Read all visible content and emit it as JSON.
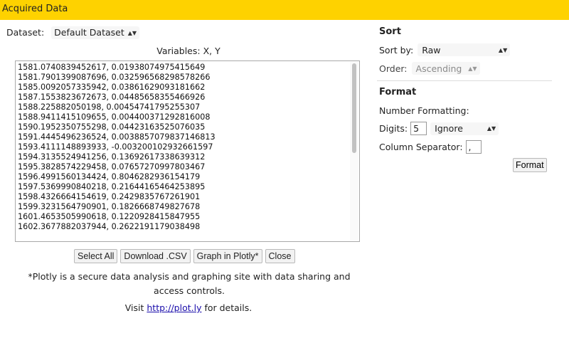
{
  "header": {
    "title": "Acquired Data"
  },
  "dataset": {
    "label": "Dataset:",
    "selected": "Default Dataset"
  },
  "variables": {
    "label": "Variables: X, Y"
  },
  "data_lines": [
    "1581.0740839452617, 0.01938074975415649",
    "1581.7901399087696, 0.032596568298578266",
    "1585.0092057335942, 0.03861629093181662",
    "1587.1553823672673, 0.04485658355466926",
    "1588.225882050198, 0.00454741795255307",
    "1588.9411415109655, 0.004400371292816008",
    "1590.1952350755298, 0.04423163525076035",
    "1591.4445496236524, 0.0038857079837146813",
    "1593.4111148893933, -0.003200102932661597",
    "1594.3135524941256, 0.13692617338639312",
    "1595.3828574229458, 0.07657270997803467",
    "1596.4991560134424, 0.8046282936154179",
    "1597.5369990840218, 0.21644165464253895",
    "1598.4326664154619, 0.2429835767261901",
    "1599.3231564790901, 0.1826668749827678",
    "1601.4653505990618, 0.1220928415847955",
    "1602.3677882037944, 0.2622191179038498"
  ],
  "actions": {
    "select_all": "Select All",
    "download_csv": "Download .CSV",
    "graph_plotly": "Graph in Plotly*",
    "close": "Close"
  },
  "note": {
    "text": "*Plotly is a secure data analysis and graphing site with data sharing and access controls.",
    "visit_prefix": "Visit",
    "link": "http://plot.ly",
    "visit_suffix": "for details."
  },
  "sort": {
    "title": "Sort",
    "sort_by_label": "Sort by:",
    "sort_by_value": "Raw",
    "order_label": "Order:",
    "order_value": "Ascending"
  },
  "format": {
    "title": "Format",
    "number_formatting_label": "Number Formatting:",
    "digits_label": "Digits:",
    "digits_value": "5",
    "digits_mode": "Ignore",
    "column_separator_label": "Column Separator:",
    "column_separator_value": ",",
    "format_button": "Format"
  },
  "colors": {
    "title_bar": "#fed200",
    "link": "#1a0dab"
  }
}
